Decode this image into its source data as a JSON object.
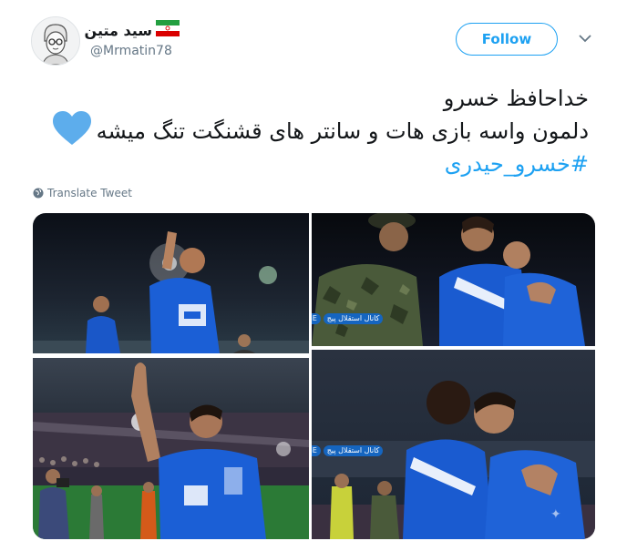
{
  "user": {
    "display_name": "سید متین",
    "handle": "@Mrmatin78"
  },
  "follow_button": {
    "label": "Follow"
  },
  "tweet": {
    "line1": "خداحافظ خسرو",
    "line2": "دلمون واسه بازی هات و سانتر های قشنگت تنگ میشه",
    "hashtag": "#خسرو_حیدری"
  },
  "translate": {
    "label": "Translate Tweet"
  },
  "watermark": {
    "channel_label": "کانال استقلال پیج",
    "brand_label": "ESTEGHLALPAGE"
  },
  "colors": {
    "accent": "#1da1f2",
    "heart": "#5dadec",
    "secondary_text": "#657786"
  },
  "icons": [
    "iran-flag-icon",
    "chevron-down-icon",
    "blue-heart-icon",
    "globe-icon"
  ]
}
